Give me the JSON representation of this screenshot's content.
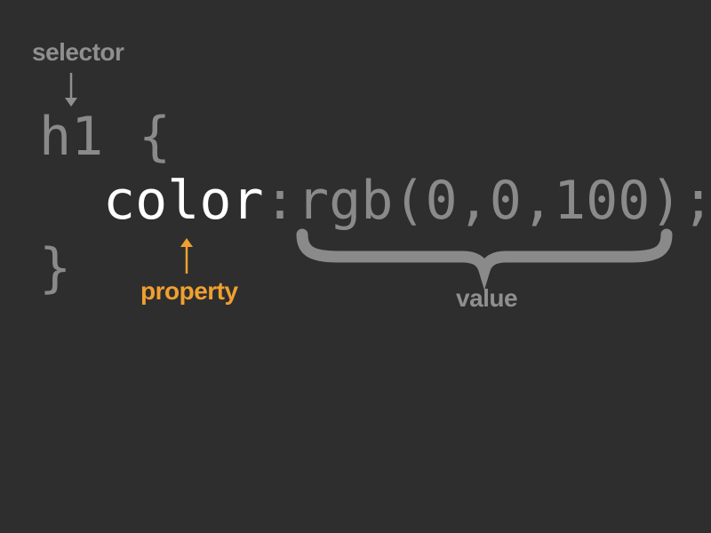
{
  "code": {
    "selector": "h1",
    "open_brace": "{",
    "property": "color",
    "colon": ":",
    "value": "rgb(0,0,100);",
    "close_brace": "}"
  },
  "annotations": {
    "selector_label": "selector",
    "property_label": "property",
    "value_label": "value"
  },
  "colors": {
    "background": "#2e2e2e",
    "muted_code": "#8a8a8a",
    "property_code": "#ffffff",
    "label_gray": "#8f8f8f",
    "label_orange": "#f0a030",
    "brace_gray": "#8a8a8a"
  }
}
